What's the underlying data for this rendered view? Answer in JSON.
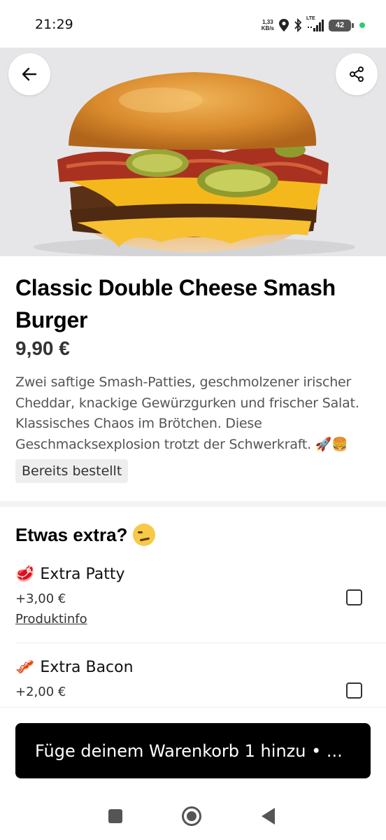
{
  "status_bar": {
    "time": "21:29",
    "net_speed_value": "1,33",
    "net_speed_unit": "KB/s",
    "network": "LTE",
    "battery": "42"
  },
  "hero": {
    "image_icon": "burger-photo",
    "back_icon": "arrow-left-icon",
    "share_icon": "share-icon"
  },
  "product": {
    "title": "Classic Double Cheese Smash Burger",
    "price": "9,90 €",
    "description": "Zwei saftige Smash-Patties, geschmolzener irischer Cheddar, knackige Gewürzgurken und frischer Salat. Klassisches Chaos im Brötchen. Diese Geschmacksexplosion trotzt der Schwerkraft. 🚀🍔",
    "badge": "Bereits bestellt"
  },
  "extras": {
    "heading": "Etwas extra?",
    "options": [
      {
        "emoji": "🥩",
        "name": "Extra Patty",
        "price": "+3,00 €",
        "info_link": "Produktinfo",
        "checked": false
      },
      {
        "emoji": "🥓",
        "name": "Extra Bacon",
        "price": "+2,00 €",
        "checked": false
      }
    ]
  },
  "cart": {
    "button_label": "Füge deinem Warenkorb 1 hinzu  • ..."
  },
  "colors": {
    "primary_button": "#000000",
    "hero_background": "#e6e6e8",
    "status_dot": "#2ecc71"
  }
}
